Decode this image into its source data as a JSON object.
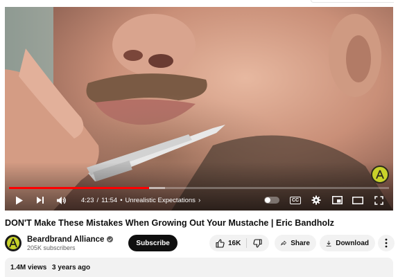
{
  "player": {
    "current_time": "4:23",
    "separator": "/",
    "duration": "11:54",
    "chapter_bullet": "•",
    "chapter": "Unrealistic Expectations",
    "played_fraction": 0.368,
    "buffered_fraction": 0.41,
    "progress_color": "#ff0000",
    "cc_label": "CC",
    "autoplay_on": false,
    "icons": [
      "play-icon",
      "next-icon",
      "volume-icon",
      "autoplay-toggle",
      "captions-icon",
      "settings-icon",
      "miniplayer-icon",
      "theater-icon",
      "fullscreen-icon"
    ]
  },
  "video": {
    "title": "DON'T Make These Mistakes When Growing Out Your Mustache | Eric Bandholz"
  },
  "channel": {
    "name": "Beardbrand Alliance",
    "subscribers": "205K subscribers",
    "subscribe_label": "Subscribe",
    "verified": true,
    "avatar_color": "#c8d22a"
  },
  "actions": {
    "likes": "16K",
    "share_label": "Share",
    "download_label": "Download",
    "more_icon": "more-vert-icon"
  },
  "description": {
    "views": "1.4M views",
    "age": "3 years ago"
  }
}
